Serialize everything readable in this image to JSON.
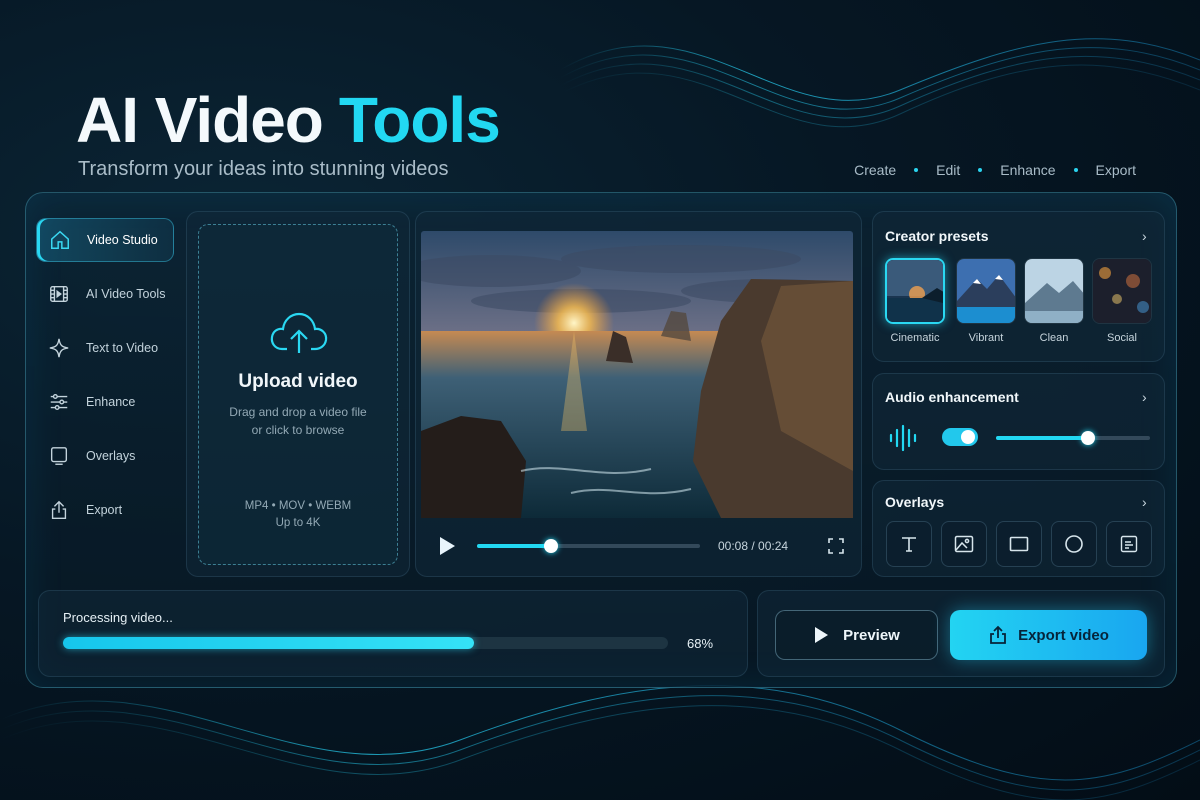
{
  "hero": {
    "title_main": "AI Video",
    "title_accent": "Tools",
    "subtitle": "Transform your ideas into stunning videos"
  },
  "steps": [
    "Create",
    "Edit",
    "Enhance",
    "Export"
  ],
  "sidebar": {
    "items": [
      {
        "label": "Video Studio",
        "icon": "home-icon",
        "active": true
      },
      {
        "label": "AI Video Tools",
        "icon": "film-icon"
      },
      {
        "label": "Text to Video",
        "icon": "sparkle-icon"
      },
      {
        "label": "Enhance",
        "icon": "sliders-icon"
      },
      {
        "label": "Overlays",
        "icon": "monitor-icon"
      },
      {
        "label": "Export",
        "icon": "share-icon"
      }
    ]
  },
  "upload": {
    "title": "Upload video",
    "desc_line1": "Drag and drop a video file",
    "desc_line2": "or click to browse",
    "formats": "MP4 • MOV • WEBM",
    "max_res": "Up to 4K"
  },
  "player": {
    "time": "00:08 / 00:24",
    "progress": 0.3333
  },
  "presets": {
    "title": "Creator presets",
    "items": [
      {
        "label": "Cinematic",
        "selected": true
      },
      {
        "label": "Vibrant"
      },
      {
        "label": "Clean"
      },
      {
        "label": "Social"
      }
    ]
  },
  "audio": {
    "title": "Audio enhancement",
    "toggle_on": true,
    "level": 0.6
  },
  "overlays": {
    "title": "Overlays",
    "tools": [
      "text-icon",
      "image-icon",
      "rectangle-icon",
      "circle-icon",
      "caption-icon"
    ]
  },
  "processing": {
    "label": "Processing video...",
    "percent": "68%",
    "progress": 0.68
  },
  "actions": {
    "preview": "Preview",
    "export": "Export video"
  },
  "colors": {
    "accent": "#22d8f2",
    "background": "#04111c"
  }
}
